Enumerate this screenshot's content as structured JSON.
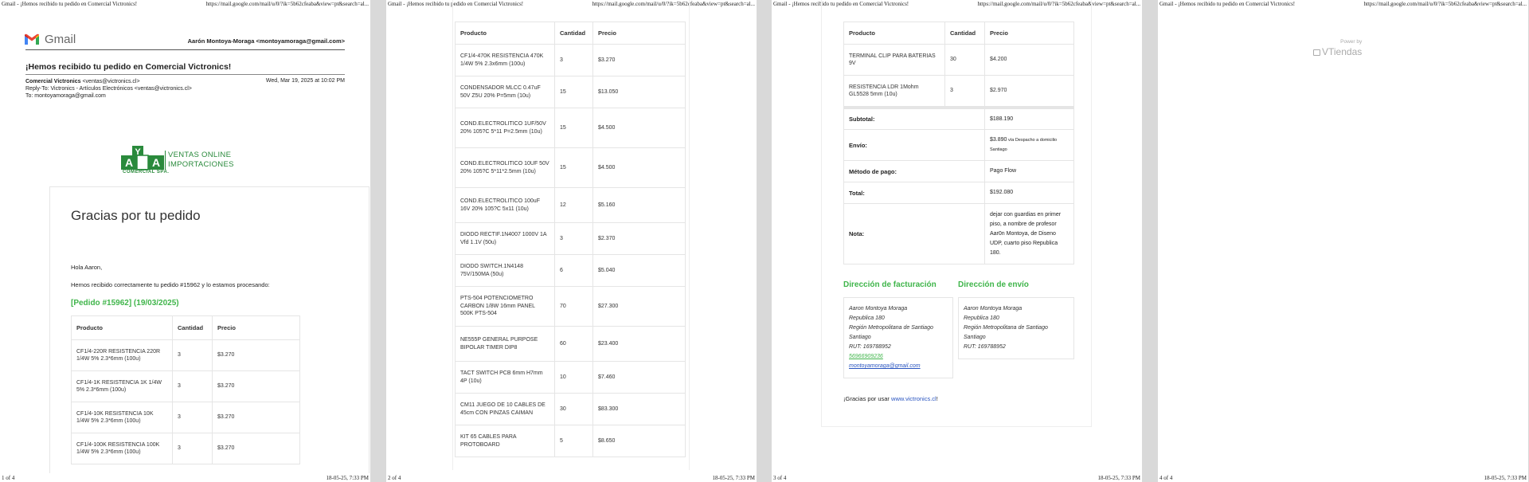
{
  "print": {
    "header_left": "Gmail - ¡Hemos recibido tu pedido en Comercial Victronics!",
    "header_right": "https://mail.google.com/mail/u/0/?ik=5b62cfeaba&view=pt&search=al...",
    "footer_date": "18-05-25, 7:33 PM",
    "pages": [
      "1 of 4",
      "2 of 4",
      "3 of 4",
      "4 of 4"
    ]
  },
  "gmail": {
    "logo_text": "Gmail",
    "account": "Aarón Montoya-Moraga <montoyamoraga@gmail.com>",
    "subject": "¡Hemos recibido tu pedido en Comercial Victronics!",
    "from_name": "Comercial Victronics",
    "from_email": " <ventas@victronics.cl>",
    "reply_to": "Reply-To: Victronics - Artículos Electrónicos <ventas@victronics.cl>",
    "to": "To: montoyamoraga@gmail.com",
    "date": "Wed, Mar 19, 2025 at 10:02 PM"
  },
  "logo": {
    "letters": "AYA",
    "line1": "VENTAS ONLINE",
    "line2": "IMPORTACIONES",
    "company": "COMERCIAL SPA."
  },
  "email": {
    "heading": "Gracias por tu pedido",
    "greeting": "Hola Aaron,",
    "message": "Hemos recibido correctamente tu pedido #15962 y lo estamos procesando:",
    "order_title": "[Pedido #15962] (19/03/2025)",
    "headers": [
      "Producto",
      "Cantidad",
      "Precio"
    ],
    "items_p1": [
      {
        "name": "CF1/4-220R RESISTENCIA 220R 1/4W 5% 2.3*6mm (100u)",
        "qty": "3",
        "price": "$3.270"
      },
      {
        "name": "CF1/4-1K RESISTENCIA 1K 1/4W 5% 2.3*6mm (100u)",
        "qty": "3",
        "price": "$3.270"
      },
      {
        "name": "CF1/4-10K RESISTENCIA 10K 1/4W 5% 2.3*6mm (100u)",
        "qty": "3",
        "price": "$3.270"
      },
      {
        "name": "CF1/4-100K RESISTENCIA 100K 1/4W 5% 2.3*6mm (100u)",
        "qty": "3",
        "price": "$3.270"
      }
    ],
    "items_p2": [
      {
        "name": "CF1/4-470K RESISTENCIA 470K 1/4W 5% 2.3x6mm (100u)",
        "qty": "3",
        "price": "$3.270"
      },
      {
        "name": "CONDENSADOR MLCC 0.47uF 50V Z5U 20% P=5mm (10u)",
        "qty": "15",
        "price": "$13.050"
      },
      {
        "name": "COND.ELECTROLITICO 1UF/50V 20% 105?C 5*11 P=2.5mm (10u)",
        "qty": "15",
        "price": "$4.500"
      },
      {
        "name": "COND.ELECTROLITICO 10UF 50V 20% 105?C 5*11*2.5mm (10u)",
        "qty": "15",
        "price": "$4.500"
      },
      {
        "name": "COND.ELECTROLITICO 100uF 16V 20% 105?C 5x11 (10u)",
        "qty": "12",
        "price": "$5.160"
      },
      {
        "name": "DIODO RECTIF.1N4007 1000V 1A Vfd 1.1V (50u)",
        "qty": "3",
        "price": "$2.370"
      },
      {
        "name": "DIODO SWITCH.1N4148 75V/150MA (50u)",
        "qty": "6",
        "price": "$5.040"
      },
      {
        "name": "PTS-504 POTENCIOMETRO CARBON 1/8W 16mm PANEL 500K PTS-504",
        "qty": "70",
        "price": "$27.300"
      },
      {
        "name": "NE555P GENERAL PURPOSE BIPOLAR TIMER DIP8",
        "qty": "60",
        "price": "$23.400"
      },
      {
        "name": "TACT SWITCH PCB 6mm H7mm 4P (10u)",
        "qty": "10",
        "price": "$7.460"
      },
      {
        "name": "CM11 JUEGO DE 10 CABLES DE 45cm CON PINZAS CAIMAN",
        "qty": "30",
        "price": "$83.300"
      },
      {
        "name": "KIT 65 CABLES PARA PROTOBOARD",
        "qty": "5",
        "price": "$8.650"
      }
    ],
    "items_p3": [
      {
        "name": "TERMINAL CLIP PARA BATERIAS 9V",
        "qty": "30",
        "price": "$4.200"
      },
      {
        "name": "RESISTENCIA LDR 1Mohm GL5528 5mm (10u)",
        "qty": "3",
        "price": "$2.970"
      }
    ],
    "totals": {
      "subtotal_label": "Subtotal:",
      "subtotal": "$188.190",
      "envio_label": "Envío:",
      "envio": "$3.890",
      "envio_via": " vía Despacho a domicilio Santiago",
      "pago_label": "Método de pago:",
      "pago": "Pago Flow",
      "total_label": "Total:",
      "total": "$192.080",
      "nota_label": "Nota:",
      "nota": "dejar con guardias en primer piso, a nombre de profesor Aar0n Montoya, de Diseno UDP, cuarto piso Republica 180."
    },
    "billing": {
      "title": "Dirección de facturación",
      "lines": [
        "Aaron Montoya Moraga",
        "Republica 180",
        "Región Metropolitana de Santiago",
        "Santiago",
        "RUT: 169788952"
      ],
      "phone": "56966909236",
      "email": "montoyamoraga@gmail.com"
    },
    "shipping": {
      "title": "Dirección de envío",
      "lines": [
        "Aaron Montoya Moraga",
        "Republica 180",
        "Región Metropolitana de Santiago",
        "Santiago",
        "RUT: 169788952"
      ]
    },
    "thanks": "¡Gracias por usar ",
    "thanks_link": "www.victronics.cl",
    "thanks_end": "!"
  },
  "footer_brand": {
    "small": "Power by",
    "name": "VTiendas"
  },
  "colors": {
    "green": "#3fb54a",
    "link": "#2a55c0"
  }
}
